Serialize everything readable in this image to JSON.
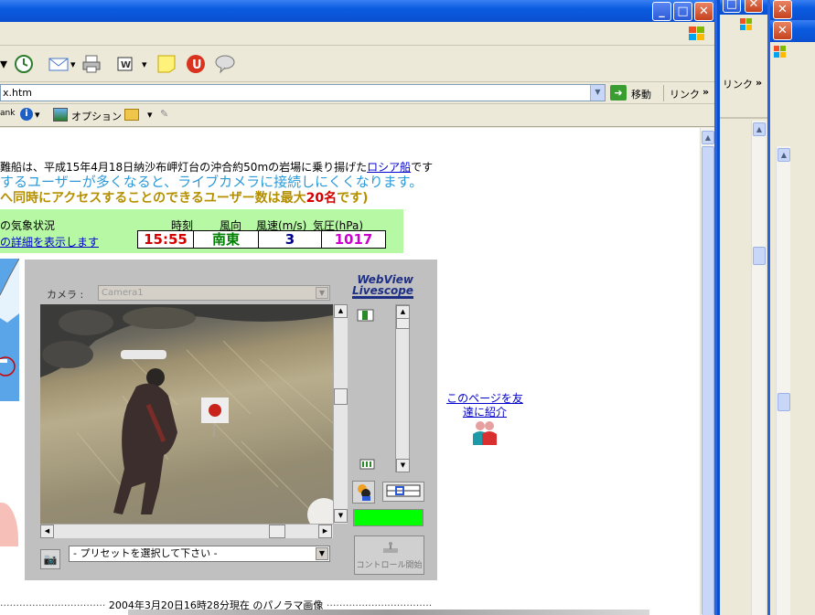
{
  "browser": {
    "address": "x.htm",
    "go_label": "移動",
    "links_label": "リンク",
    "chevron": "»",
    "links_bar": {
      "rank_label": "ank",
      "options_label": "オプション"
    }
  },
  "back_windows": {
    "win2_links_label": "リンク",
    "chevron": "»"
  },
  "page": {
    "line1_text": "難船は、平成15年4月18日納沙布岬灯台の沖合約50mの岩場に乗り揚げた",
    "line1_link": "ロシア船",
    "line1_suffix": "です",
    "line2": "するユーザーが多くなると、ライブカメラに接続しにくくなります。",
    "line3_prefix": "へ同時にアクセスすることのできるユーザー数は最大",
    "line3_highlight": "20名",
    "line3_suffix": "です)",
    "weather": {
      "title": "の気象状況",
      "detail_link": "の詳細を表示します",
      "headers": {
        "time": "時刻",
        "wind_dir": "風向",
        "wind_speed": "風速(m/s)",
        "pressure": "気圧(hPa)"
      },
      "values": {
        "time": "15:55",
        "wind_dir": "南東",
        "wind_speed": "3",
        "pressure": "1017"
      },
      "colors": {
        "time": "#d40000",
        "wind_dir": "#008000",
        "wind_speed": "#00008b",
        "pressure": "#cc00cc"
      }
    },
    "camera": {
      "label": "カメラ :",
      "selected_camera": "Camera1",
      "logo_line1": "WebView",
      "logo_line2": "Livescope",
      "preset_placeholder": "- プリセットを選択して下さい -",
      "control_start_label": "コントロール開始"
    },
    "share_link": "このページを友達に紹介",
    "caption": "2004年3月20日16時28分現在 のパノラマ画像"
  }
}
